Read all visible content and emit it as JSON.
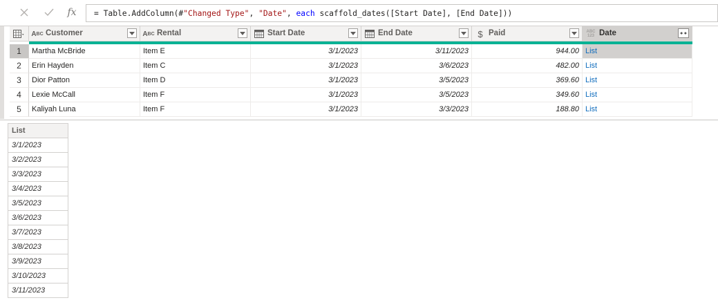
{
  "formula": {
    "prefix": "= Table.AddColumn(#",
    "arg1": "\"Changed Type\"",
    "sep1": ", ",
    "arg2": "\"Date\"",
    "sep2": ", ",
    "keyword": "each",
    "rest": " scaffold_dates([Start Date], [End Date]))"
  },
  "columns": [
    {
      "label": "Customer",
      "type_icon": "text-type-icon",
      "type_glyph": "ABC"
    },
    {
      "label": "Rental",
      "type_icon": "text-type-icon",
      "type_glyph": "ABC"
    },
    {
      "label": "Start Date",
      "type_icon": "date-type-icon",
      "type_glyph": "▦"
    },
    {
      "label": "End Date",
      "type_icon": "date-type-icon",
      "type_glyph": "▦"
    },
    {
      "label": "Paid",
      "type_icon": "currency-type-icon",
      "type_glyph": "$"
    },
    {
      "label": "Date",
      "type_icon": "any-type-icon",
      "type_glyph": "ABC123"
    }
  ],
  "rows": [
    {
      "num": "1",
      "customer": "Martha McBride",
      "rental": "Item E",
      "start": "3/1/2023",
      "end": "3/11/2023",
      "paid": "944.00",
      "date": "List"
    },
    {
      "num": "2",
      "customer": "Erin Hayden",
      "rental": "Item C",
      "start": "3/1/2023",
      "end": "3/6/2023",
      "paid": "482.00",
      "date": "List"
    },
    {
      "num": "3",
      "customer": "Dior Patton",
      "rental": "Item D",
      "start": "3/1/2023",
      "end": "3/5/2023",
      "paid": "369.60",
      "date": "List"
    },
    {
      "num": "4",
      "customer": "Lexie McCall",
      "rental": "Item F",
      "start": "3/1/2023",
      "end": "3/5/2023",
      "paid": "349.60",
      "date": "List"
    },
    {
      "num": "5",
      "customer": "Kaliyah Luna",
      "rental": "Item F",
      "start": "3/1/2023",
      "end": "3/3/2023",
      "paid": "188.80",
      "date": "List"
    }
  ],
  "preview": {
    "header": "List",
    "items": [
      "3/1/2023",
      "3/2/2023",
      "3/3/2023",
      "3/4/2023",
      "3/5/2023",
      "3/6/2023",
      "3/7/2023",
      "3/8/2023",
      "3/9/2023",
      "3/10/2023",
      "3/11/2023"
    ]
  },
  "colors": {
    "accent": "#00b294",
    "list_link": "#0f6cbd"
  }
}
